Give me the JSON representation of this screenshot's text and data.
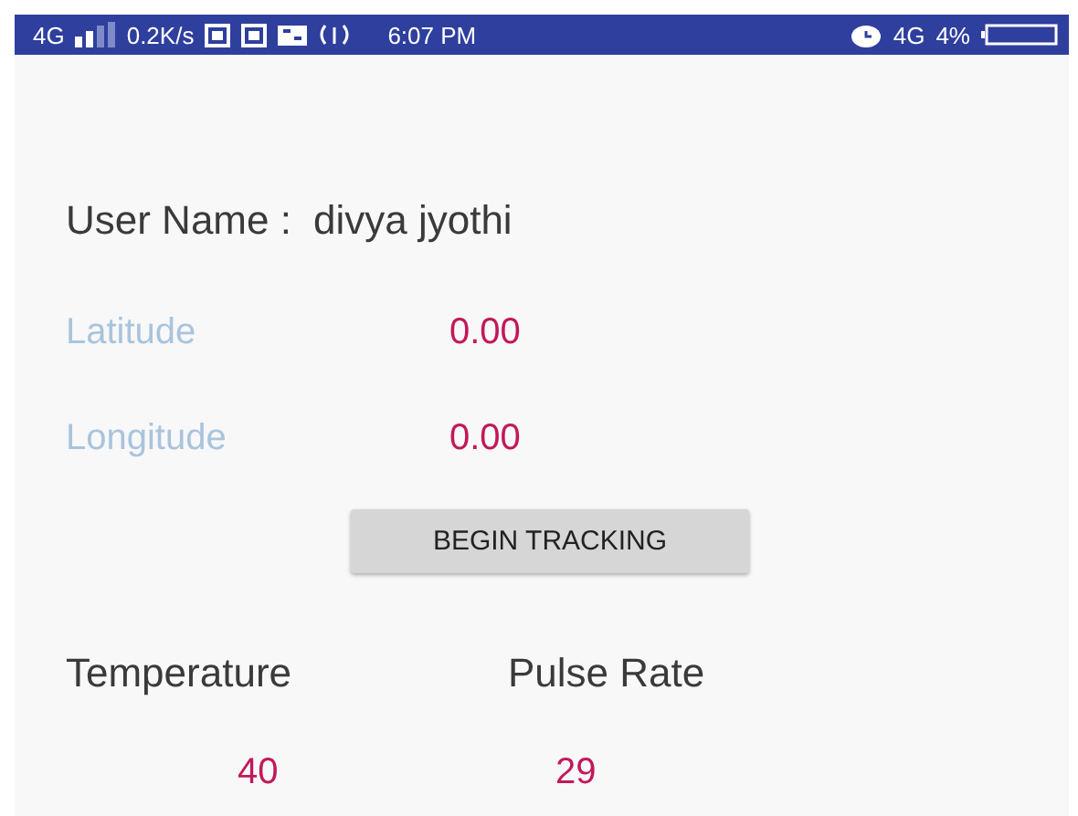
{
  "status_bar": {
    "network": "4G",
    "speed": "0.2K/s",
    "time": "6:07 PM",
    "data_type": "4G",
    "battery": "4%"
  },
  "user": {
    "label": "User Name :",
    "value": "divya jyothi"
  },
  "coordinates": [
    {
      "label": "Latitude",
      "value": "0.00"
    },
    {
      "label": "Longitude",
      "value": "0.00"
    }
  ],
  "button": "BEGIN TRACKING",
  "vitals": [
    {
      "label": "Temperature",
      "value": "40"
    },
    {
      "label": "Pulse Rate",
      "value": "29"
    }
  ]
}
